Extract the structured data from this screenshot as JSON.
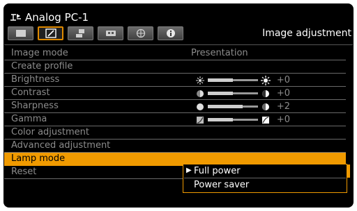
{
  "header": {
    "source_title": "Analog PC-1",
    "page_heading": "Image adjustment"
  },
  "tabs": [
    {
      "icon": "image-tab-icon"
    },
    {
      "icon": "picture-adjust-tab-icon",
      "active": true
    },
    {
      "icon": "install-tab-icon"
    },
    {
      "icon": "system-tab-icon"
    },
    {
      "icon": "network-tab-icon"
    },
    {
      "icon": "information-tab-icon"
    }
  ],
  "menu": {
    "image_mode": {
      "label": "Image mode",
      "value": "Presentation"
    },
    "create_profile": {
      "label": "Create profile"
    },
    "brightness": {
      "label": "Brightness",
      "value": "+0",
      "level": 0.5
    },
    "contrast": {
      "label": "Contrast",
      "value": "+0",
      "level": 0.5
    },
    "sharpness": {
      "label": "Sharpness",
      "value": "+2",
      "level": 0.7
    },
    "gamma": {
      "label": "Gamma",
      "value": "+0",
      "level": 0.5
    },
    "color_adjustment": {
      "label": "Color adjustment"
    },
    "advanced_adjustment": {
      "label": "Advanced adjustment"
    },
    "lamp_mode": {
      "label": "Lamp mode"
    },
    "reset": {
      "label": "Reset"
    }
  },
  "lamp_options": [
    {
      "label": "Full power",
      "selected": true
    },
    {
      "label": "Power saver",
      "selected": false
    }
  ],
  "colors": {
    "accent": "#f09a00",
    "disabled_text": "#8c8c8c"
  }
}
